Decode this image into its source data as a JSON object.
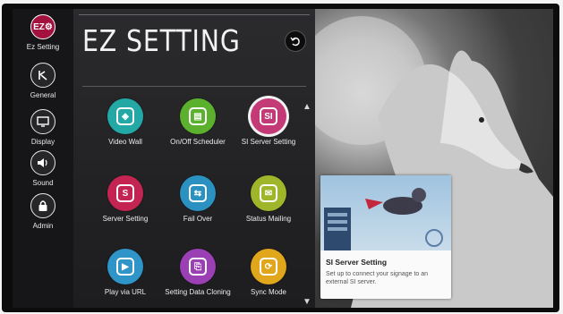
{
  "sidebar": {
    "items": [
      {
        "label": "Ez Setting",
        "icon": "ez-icon",
        "glyph": "EZ⚙"
      },
      {
        "label": "General",
        "icon": "general-settings-icon",
        "glyph": "⚙"
      },
      {
        "label": "Display",
        "icon": "display-icon",
        "glyph": "▣"
      },
      {
        "label": "Sound",
        "icon": "speaker-icon",
        "glyph": "◀"
      },
      {
        "label": "Admin",
        "icon": "lock-icon",
        "glyph": "🔒"
      }
    ]
  },
  "main": {
    "title": "EZ SETTING",
    "items": [
      {
        "label": "Video Wall",
        "color": "#23a8a6",
        "icon": "video-wall-icon",
        "glyph": "◈"
      },
      {
        "label": "On/Off Scheduler",
        "color": "#5bb12d",
        "icon": "scheduler-icon",
        "glyph": "▤"
      },
      {
        "label": "SI Server Setting",
        "color": "#c43a76",
        "icon": "si-server-icon",
        "glyph": "SI"
      },
      {
        "label": "Server Setting",
        "color": "#c42451",
        "icon": "server-setting-icon",
        "glyph": "S"
      },
      {
        "label": "Fail Over",
        "color": "#2a91c1",
        "icon": "fail-over-icon",
        "glyph": "⇆"
      },
      {
        "label": "Status Mailing",
        "color": "#9fb62a",
        "icon": "status-mailing-icon",
        "glyph": "✉"
      },
      {
        "label": "Play via URL",
        "color": "#2f94c7",
        "icon": "play-url-icon",
        "glyph": "▶"
      },
      {
        "label": "Setting Data Cloning",
        "color": "#9a3fb4",
        "icon": "data-cloning-icon",
        "glyph": "⎘"
      },
      {
        "label": "Sync Mode",
        "color": "#e0a71c",
        "icon": "sync-mode-icon",
        "glyph": "⟳"
      }
    ]
  },
  "card": {
    "title": "SI Server Setting",
    "description": "Set up to connect your signage to an external SI server."
  }
}
